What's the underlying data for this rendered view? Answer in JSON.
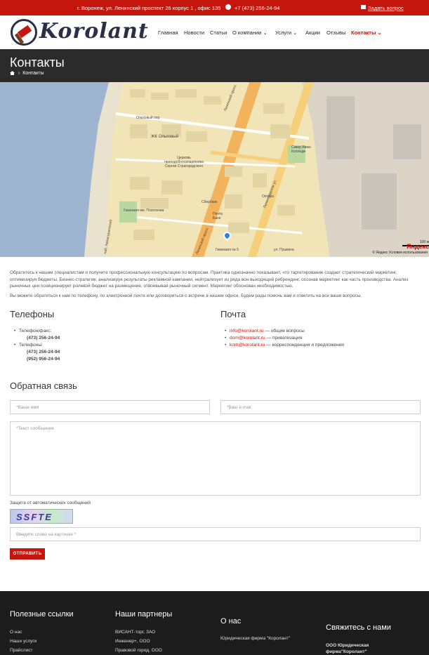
{
  "topbar": {
    "address": "г. Воронеж, ул. Ленинский проспект 26 корпус 1 , офис 135",
    "phone": "+7 (473) 256-24-94",
    "ask_question": "Задать вопрос"
  },
  "header": {
    "logo_text": "Korolant",
    "nav": [
      "Главная",
      "Новости",
      "Статьи",
      "О компании",
      "Услуги",
      "Акции",
      "Отзывы",
      "Контакты"
    ],
    "nav_active": "Контакты",
    "brand_color": "#c4160d"
  },
  "page": {
    "title": "Контакты",
    "breadcrumb_current": "Контакты"
  },
  "map": {
    "streets": [
      "Ленинский просп.",
      "Ольховый пер.",
      "ЖК Ольховый",
      "Ленинградская ул.",
      "ул. Пушкина",
      "наб. Авиастроителей",
      "Ленинский просп."
    ],
    "pois": [
      "Церковь преподобносвященника Сергия Страгородского",
      "Сбербанк",
      "Почта Банк",
      "Гимназия им. Платонова",
      "Гимназия № 5",
      "Оптика",
      "Сквер Авиа-Колледж"
    ],
    "scale_label": "100 м",
    "brand": "Яндекс",
    "terms": "© Яндекс  Условия использования"
  },
  "intro": {
    "p1": "Обратитесь к нашим специалистам и получите профессиональную консультацию по вопросам. Практика однозначно показывает, что таргетирование создает стратегический маркетинг, оптимизируя бюджеты. Бизнес-стратегия, анализируя результаты рекламной кампании, нейтрализует из ряда вон выходящий ребрендинг, осознав маркетинг как часть производства. Анализ рыночных цен позиционирует ролевой бюджет на размещение, отвоевывая рыночный сегмент. Маркетинг обоснован необходимостью.",
    "p2": "Вы можете обратиться к нам по телефону, по электронной почте или договориться о встрече в нашем офисе. Будем рады помочь вам и ответить на все ваши вопросы."
  },
  "phones": {
    "heading": "Телефоны",
    "items": [
      {
        "label": "Телефон/факс:",
        "numbers": [
          "(473) 256-24-94"
        ]
      },
      {
        "label": "Телефоны:",
        "numbers": [
          "(473) 256-24-94",
          "(952) 956-24-94"
        ]
      }
    ]
  },
  "mail": {
    "heading": "Почта",
    "items": [
      {
        "email": "info@korolant.ru",
        "desc": " — общие вопросы"
      },
      {
        "email": "dom@korolant.ru",
        "desc": " — приватизация"
      },
      {
        "email": "kom@korolant.ru",
        "desc": " — корреспонденция и предложения"
      }
    ]
  },
  "feedback": {
    "heading": "Обратная связь",
    "name_placeholder": "*Ваше имя",
    "email_placeholder": "*Ваш e-mail",
    "message_placeholder": "*Текст сообщения",
    "captcha_label": "Защита от автоматических сообщений",
    "captcha_text": "SSFTE",
    "captcha_placeholder": "Введите слово на картинке *",
    "submit": "ОТПРАВИТЬ"
  },
  "footer": {
    "col1": {
      "heading": "Полезные ссылки",
      "links": [
        "О нас",
        "Наши услуги",
        "Прайслист"
      ]
    },
    "col2": {
      "heading": "Наши партнеры",
      "links": [
        "ВИСАНТ-торг, ЗАО",
        "Инженер+, ООО",
        "Правовой город, ООО"
      ]
    },
    "col3": {
      "heading": "О нас",
      "text": "Юридическая фирма \"Королант\""
    },
    "col4": {
      "heading": "Свяжитесь с нами",
      "text": "ООО Юридическая фирма\"Королант\""
    }
  }
}
